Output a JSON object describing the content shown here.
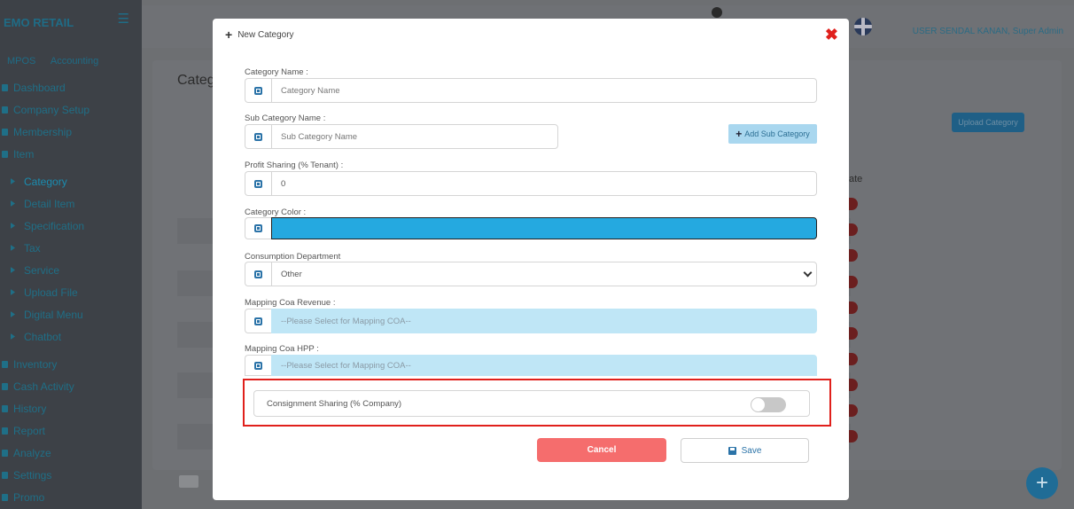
{
  "app": {
    "brand": "EMO RETAIL",
    "top_tabs": [
      "MPOS",
      "Accounting"
    ],
    "user": "USER SENDAL KANAN, Super Admin"
  },
  "sidebar": {
    "items": [
      {
        "label": "Dashboard",
        "type": "main"
      },
      {
        "label": "Company Setup",
        "type": "main"
      },
      {
        "label": "Membership",
        "type": "main"
      },
      {
        "label": "Item",
        "type": "main"
      },
      {
        "label": "Category",
        "type": "sub",
        "active": true
      },
      {
        "label": "Detail Item",
        "type": "sub"
      },
      {
        "label": "Specification",
        "type": "sub"
      },
      {
        "label": "Tax",
        "type": "sub"
      },
      {
        "label": "Service",
        "type": "sub"
      },
      {
        "label": "Upload File",
        "type": "sub"
      },
      {
        "label": "Digital Menu",
        "type": "sub"
      },
      {
        "label": "Chatbot",
        "type": "sub"
      },
      {
        "label": "Inventory",
        "type": "main"
      },
      {
        "label": "Cash Activity",
        "type": "main"
      },
      {
        "label": "History",
        "type": "main"
      },
      {
        "label": "Report",
        "type": "main"
      },
      {
        "label": "Analyze",
        "type": "main"
      },
      {
        "label": "Settings",
        "type": "main"
      },
      {
        "label": "Promo",
        "type": "main"
      }
    ]
  },
  "background": {
    "page_title": "Categ",
    "upload_button": "Upload Category",
    "column_header": "ate",
    "page_button": "Prev"
  },
  "modal": {
    "title": "New Category",
    "fields": {
      "category_name": {
        "label": "Category Name :",
        "placeholder": "Category Name",
        "value": ""
      },
      "sub_category_name": {
        "label": "Sub Category Name :",
        "placeholder": "Sub Category Name",
        "value": ""
      },
      "add_sub_category": "Add Sub Category",
      "profit_sharing": {
        "label": "Profit Sharing (% Tenant) :",
        "value": "0"
      },
      "category_color": {
        "label": "Category Color :",
        "value": "#25a9e0"
      },
      "consumption_department": {
        "label": "Consumption Department",
        "value": "Other"
      },
      "mapping_coa_revenue": {
        "label": "Mapping Coa Revenue :",
        "placeholder": "--Please Select for Mapping COA--"
      },
      "mapping_coa_hpp": {
        "label": "Mapping Coa HPP :",
        "placeholder": "--Please Select for Mapping COA--"
      },
      "consignment_sharing": {
        "label": "Consignment Sharing (% Company)",
        "enabled": false
      }
    },
    "buttons": {
      "cancel": "Cancel",
      "save": "Save"
    }
  },
  "colors": {
    "accent": "#2b73a8",
    "cancel": "#f56d6d",
    "highlight": "#e0201c",
    "coa_select": "#bfe6f6"
  }
}
